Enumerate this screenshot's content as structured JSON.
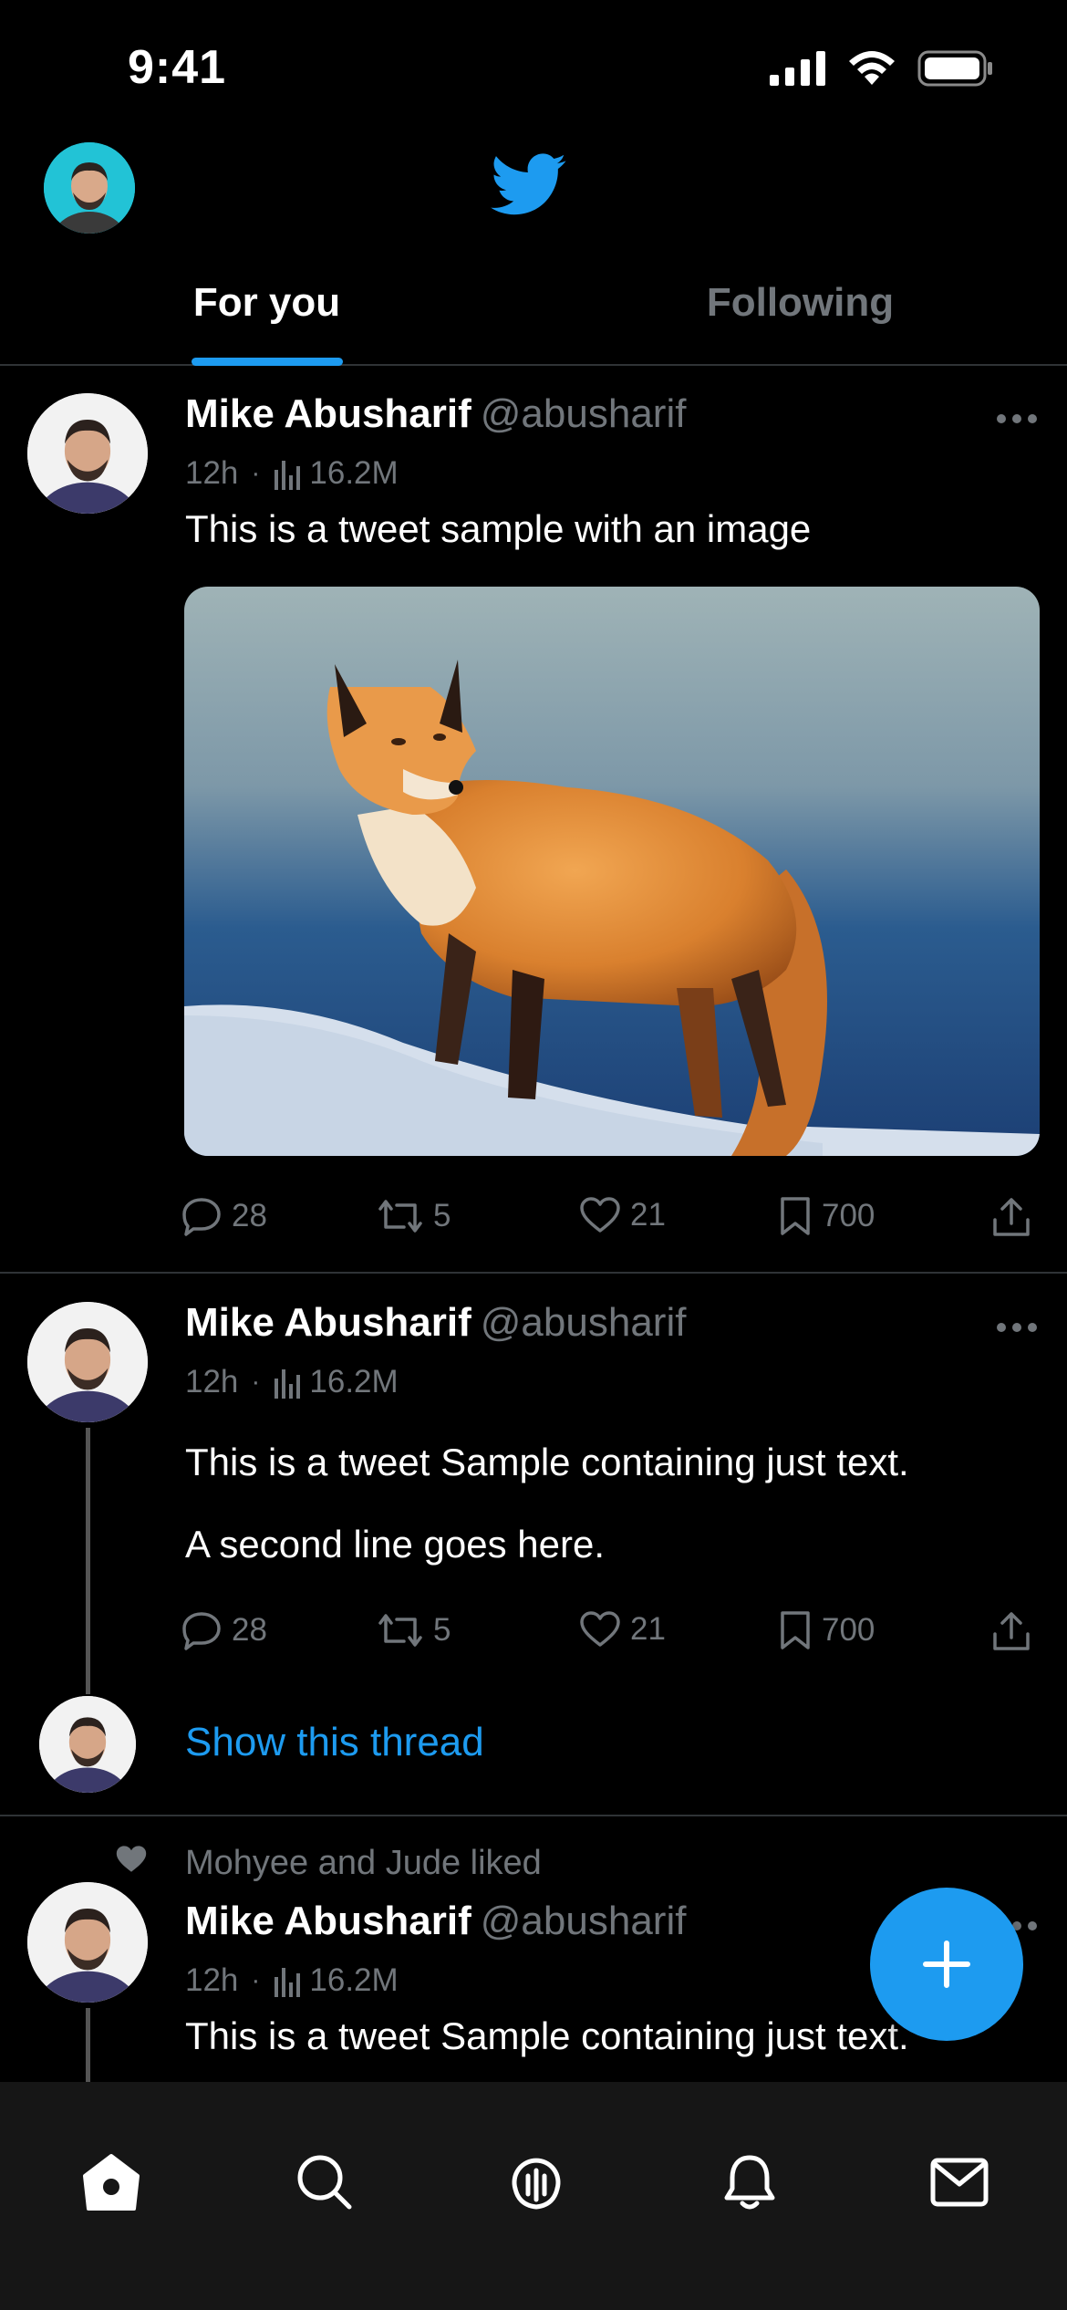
{
  "status_bar": {
    "time": "9:41"
  },
  "header": {
    "logo_icon": "bird-logo-icon"
  },
  "tabs": [
    {
      "label": "For you",
      "active": true
    },
    {
      "label": "Following",
      "active": false
    }
  ],
  "tweets": [
    {
      "name": "Mike Abusharif",
      "handle": "@abusharif",
      "time": "12h",
      "views": "16.2M",
      "text": [
        "This is a tweet sample with an image"
      ],
      "has_image": true,
      "actions": {
        "replies": "28",
        "retweets": "5",
        "likes": "21",
        "bookmarks": "700"
      }
    },
    {
      "name": "Mike Abusharif",
      "handle": "@abusharif",
      "time": "12h",
      "views": "16.2M",
      "text": [
        "This is a tweet Sample containing just text.",
        "A second line goes here."
      ],
      "has_image": false,
      "actions": {
        "replies": "28",
        "retweets": "5",
        "likes": "21",
        "bookmarks": "700"
      },
      "show_thread": "Show this thread"
    },
    {
      "liked_by": "Mohyee and Jude liked",
      "name": "Mike Abusharif",
      "handle": "@abusharif",
      "time": "12h",
      "views": "16.2M",
      "text": [
        "This is a tweet Sample containing just text."
      ]
    }
  ],
  "colors": {
    "accent": "#1d9bf0",
    "background": "#000000",
    "muted": "#71767b"
  },
  "bottom_nav": [
    "home-icon",
    "search-icon",
    "spaces-icon",
    "notifications-icon",
    "messages-icon"
  ]
}
